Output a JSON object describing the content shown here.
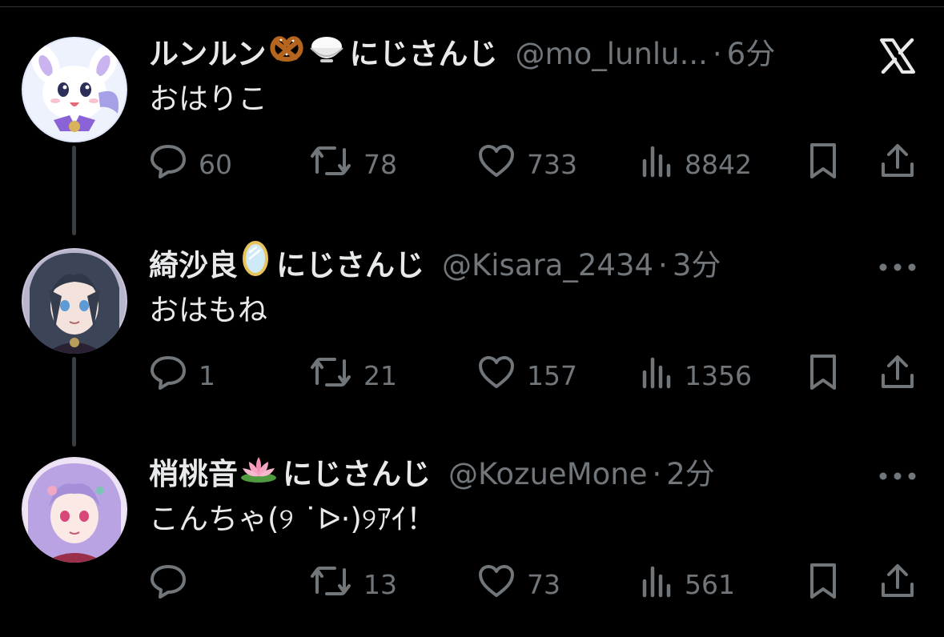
{
  "tweets": [
    {
      "display_name": "ルンルン",
      "emojis": [
        "pretzel-emoji",
        "rice-bowl-emoji"
      ],
      "affiliation": "にじさんじ",
      "handle": "@mo_lunlu...",
      "separator": "·",
      "time": "6分",
      "corner_icon": "x-logo-icon",
      "text": "おはりこ",
      "reply_count": "60",
      "retweet_count": "78",
      "like_count": "733",
      "view_count": "8842"
    },
    {
      "display_name": "綺沙良",
      "emojis": [
        "mirror-emoji"
      ],
      "affiliation": "にじさんじ",
      "handle": "@Kisara_2434",
      "separator": "·",
      "time": "3分",
      "corner_icon": "more-icon",
      "text": "おはもね",
      "reply_count": "1",
      "retweet_count": "21",
      "like_count": "157",
      "view_count": "1356"
    },
    {
      "display_name": "梢桃音",
      "emojis": [
        "lotus-emoji"
      ],
      "affiliation": "にじさんじ",
      "handle": "@KozueMone",
      "separator": "·",
      "time": "2分",
      "corner_icon": "more-icon",
      "text": "こんちゃ(୨ ˙ᐅ·)୨ｱｲ！",
      "reply_count": "",
      "retweet_count": "13",
      "like_count": "73",
      "view_count": "561"
    }
  ],
  "colors": {
    "background": "#000000",
    "primary_text": "#e7e9ea",
    "secondary_text": "#71767b",
    "thread_line": "#3a3d40"
  }
}
